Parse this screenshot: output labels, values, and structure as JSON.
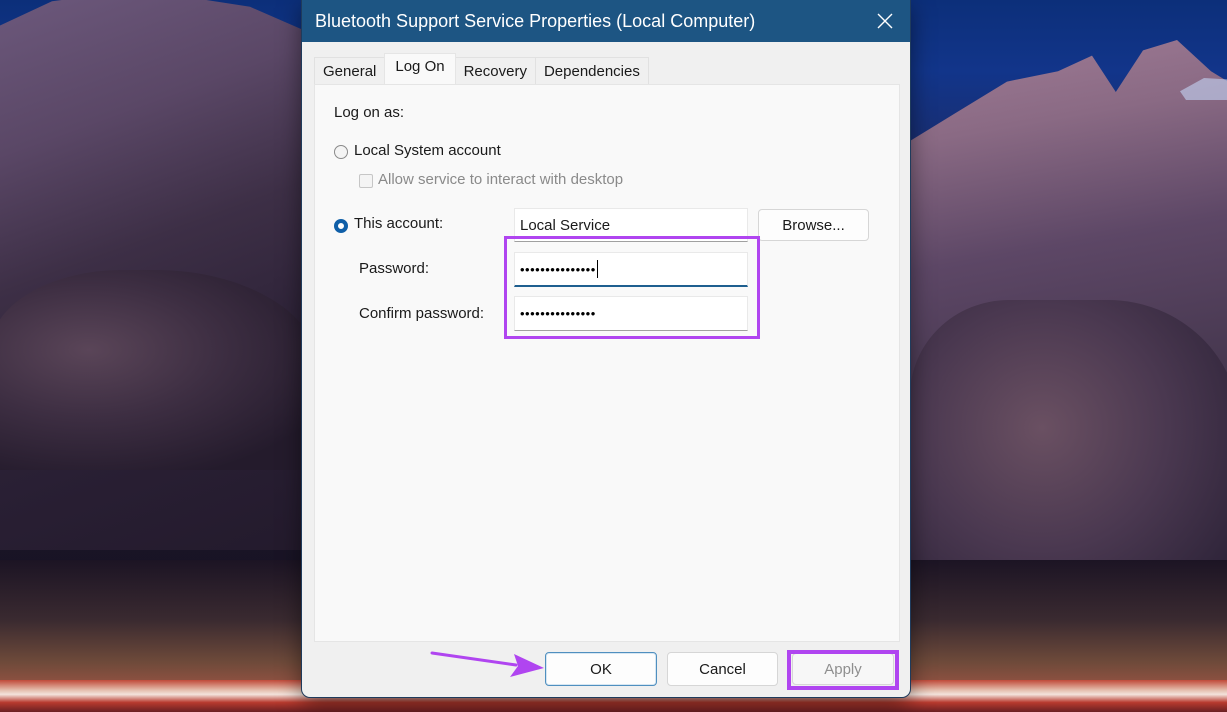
{
  "dialog": {
    "title": "Bluetooth Support Service Properties (Local Computer)",
    "close_icon": "close-icon",
    "tabs": [
      {
        "label": "General",
        "active": false
      },
      {
        "label": "Log On",
        "active": true
      },
      {
        "label": "Recovery",
        "active": false
      },
      {
        "label": "Dependencies",
        "active": false
      }
    ],
    "logon": {
      "heading": "Log on as:",
      "local_system_label": "Local System account",
      "local_system_selected": false,
      "interact_desktop_label": "Allow service to interact with desktop",
      "interact_desktop_checked": false,
      "interact_desktop_enabled": false,
      "this_account_label": "This account:",
      "this_account_selected": true,
      "account_value": "Local Service",
      "browse_label": "Browse...",
      "password_label": "Password:",
      "password_value": "•••••••••••••••",
      "confirm_password_label": "Confirm password:",
      "confirm_password_value": "•••••••••••••••"
    },
    "footer": {
      "ok_label": "OK",
      "cancel_label": "Cancel",
      "apply_label": "Apply",
      "apply_enabled": false
    }
  },
  "annotations": {
    "highlight_color": "#b045f0",
    "highlighted": [
      "password-fields",
      "apply-button"
    ],
    "arrow_target": "ok-button"
  },
  "colors": {
    "titlebar": "#1d5583",
    "accent": "#0f5fa8",
    "dialog_bg": "#f0f0f0"
  }
}
